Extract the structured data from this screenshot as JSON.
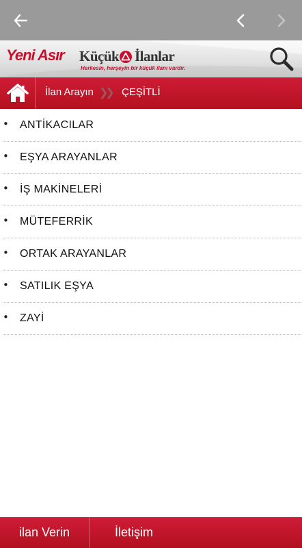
{
  "appbar": {
    "back_icon": "arrow-left-icon",
    "prev_icon": "chevron-left-icon",
    "next_icon": "chevron-right-icon"
  },
  "brand": {
    "logo_primary": "Yeni Asır",
    "logo_secondary_1": "Küçük",
    "logo_secondary_2": "İlanlar",
    "slogan": "Herkesin, herşeyin bir küçük ilanı vardır.",
    "brand_red": "#c8102e",
    "search_icon": "search-icon"
  },
  "breadcrumb": {
    "home_icon": "home-icon",
    "link": "İlan Arayın",
    "separator": "»",
    "current": "ÇEŞİTLİ"
  },
  "categories": [
    {
      "label": "ANTİKACILAR"
    },
    {
      "label": "EŞYA ARAYANLAR"
    },
    {
      "label": "İŞ MAKİNELERİ"
    },
    {
      "label": "MÜTEFERRİK"
    },
    {
      "label": "ORTAK ARAYANLAR"
    },
    {
      "label": "SATILIK EŞYA"
    },
    {
      "label": "ZAYİ"
    }
  ],
  "bullet": "•",
  "footer": {
    "ilan_verin": "ilan Verin",
    "iletisim": "İletişim"
  }
}
